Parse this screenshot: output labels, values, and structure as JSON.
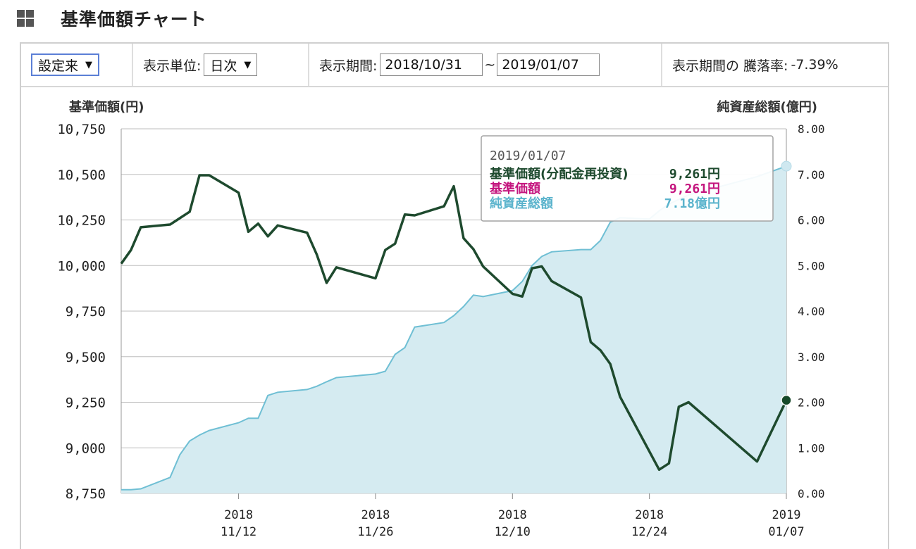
{
  "header": {
    "title": "基準価額チャート",
    "icon": "grid-icon"
  },
  "controls": {
    "period_select": "設定来",
    "unit_label": "表示単位:",
    "unit_select": "日次",
    "range_label": "表示期間:",
    "start_date": "2018/10/31",
    "range_sep": "~",
    "end_date": "2019/01/07",
    "change_label": "表示期間の 騰落率:",
    "change_value": "-7.39%"
  },
  "chart_data": {
    "type": "line",
    "left_axis_label": "基準価額(円)",
    "right_axis_label": "純資産総額(億円)",
    "y_left_ticks": [
      "10,750",
      "10,500",
      "10,250",
      "10,000",
      "9,750",
      "9,500",
      "9,250",
      "9,000",
      "8,750"
    ],
    "y_right_ticks": [
      "8.00",
      "7.00",
      "6.00",
      "5.00",
      "4.00",
      "3.00",
      "2.00",
      "1.00",
      "0.00"
    ],
    "ylim_left": [
      8750,
      10750
    ],
    "ylim_right": [
      0,
      8
    ],
    "x_ticks": [
      {
        "year": "2018",
        "md": "11/12",
        "date": "2018-11-12"
      },
      {
        "year": "2018",
        "md": "11/26",
        "date": "2018-11-26"
      },
      {
        "year": "2018",
        "md": "12/10",
        "date": "2018-12-10"
      },
      {
        "year": "2018",
        "md": "12/24",
        "date": "2018-12-24"
      },
      {
        "year": "2019",
        "md": "01/07",
        "date": "2019-01-07"
      }
    ],
    "xlim": [
      "2018-10-31",
      "2019-01-07"
    ],
    "grid": true,
    "nav_color": "#1e4a2e",
    "aum_line_color": "#6fbfd4",
    "aum_fill_color": "#d5ebf1",
    "series": [
      {
        "axis": "left",
        "points": [
          [
            "2018-10-31",
            10010
          ],
          [
            "2018-11-01",
            10085
          ],
          [
            "2018-11-02",
            10210
          ],
          [
            "2018-11-05",
            10225
          ],
          [
            "2018-11-07",
            10295
          ],
          [
            "2018-11-08",
            10495
          ],
          [
            "2018-11-09",
            10495
          ],
          [
            "2018-11-12",
            10400
          ],
          [
            "2018-11-13",
            10185
          ],
          [
            "2018-11-14",
            10230
          ],
          [
            "2018-11-15",
            10160
          ],
          [
            "2018-11-16",
            10220
          ],
          [
            "2018-11-19",
            10180
          ],
          [
            "2018-11-20",
            10060
          ],
          [
            "2018-11-21",
            9905
          ],
          [
            "2018-11-22",
            9990
          ],
          [
            "2018-11-26",
            9930
          ],
          [
            "2018-11-27",
            10085
          ],
          [
            "2018-11-28",
            10120
          ],
          [
            "2018-11-29",
            10280
          ],
          [
            "2018-11-30",
            10275
          ],
          [
            "2018-12-03",
            10325
          ],
          [
            "2018-12-04",
            10435
          ],
          [
            "2018-12-05",
            10150
          ],
          [
            "2018-12-06",
            10090
          ],
          [
            "2018-12-07",
            9995
          ],
          [
            "2018-12-10",
            9845
          ],
          [
            "2018-12-11",
            9830
          ],
          [
            "2018-12-12",
            9985
          ],
          [
            "2018-12-13",
            9995
          ],
          [
            "2018-12-14",
            9915
          ],
          [
            "2018-12-17",
            9825
          ],
          [
            "2018-12-18",
            9580
          ],
          [
            "2018-12-19",
            9535
          ],
          [
            "2018-12-20",
            9460
          ],
          [
            "2018-12-21",
            9280
          ],
          [
            "2018-12-25",
            8880
          ],
          [
            "2018-12-26",
            8915
          ],
          [
            "2018-12-27",
            9225
          ],
          [
            "2018-12-28",
            9250
          ],
          [
            "2019-01-04",
            8925
          ],
          [
            "2019-01-07",
            9261
          ]
        ]
      },
      {
        "axis": "right",
        "points": [
          [
            "2018-10-31",
            0.08
          ],
          [
            "2018-11-01",
            0.08
          ],
          [
            "2018-11-02",
            0.1
          ],
          [
            "2018-11-05",
            0.35
          ],
          [
            "2018-11-06",
            0.85
          ],
          [
            "2018-11-07",
            1.15
          ],
          [
            "2018-11-08",
            1.28
          ],
          [
            "2018-11-09",
            1.38
          ],
          [
            "2018-11-12",
            1.55
          ],
          [
            "2018-11-13",
            1.65
          ],
          [
            "2018-11-14",
            1.65
          ],
          [
            "2018-11-15",
            2.15
          ],
          [
            "2018-11-16",
            2.22
          ],
          [
            "2018-11-19",
            2.28
          ],
          [
            "2018-11-20",
            2.35
          ],
          [
            "2018-11-21",
            2.45
          ],
          [
            "2018-11-22",
            2.54
          ],
          [
            "2018-11-26",
            2.62
          ],
          [
            "2018-11-27",
            2.68
          ],
          [
            "2018-11-28",
            3.05
          ],
          [
            "2018-11-29",
            3.2
          ],
          [
            "2018-11-30",
            3.65
          ],
          [
            "2018-12-03",
            3.75
          ],
          [
            "2018-12-04",
            3.9
          ],
          [
            "2018-12-05",
            4.1
          ],
          [
            "2018-12-06",
            4.35
          ],
          [
            "2018-12-07",
            4.32
          ],
          [
            "2018-12-10",
            4.45
          ],
          [
            "2018-12-11",
            4.65
          ],
          [
            "2018-12-12",
            5.0
          ],
          [
            "2018-12-13",
            5.2
          ],
          [
            "2018-12-14",
            5.3
          ],
          [
            "2018-12-17",
            5.35
          ],
          [
            "2018-12-18",
            5.35
          ],
          [
            "2018-12-19",
            5.55
          ],
          [
            "2018-12-20",
            5.95
          ],
          [
            "2018-12-21",
            6.05
          ],
          [
            "2018-12-24",
            6.02
          ],
          [
            "2018-12-25",
            6.2
          ],
          [
            "2018-12-26",
            6.35
          ],
          [
            "2018-12-27",
            6.45
          ],
          [
            "2018-12-28",
            6.55
          ],
          [
            "2019-01-04",
            6.95
          ],
          [
            "2019-01-07",
            7.18
          ]
        ]
      }
    ],
    "tooltip": {
      "date": "2019/01/07",
      "rows": [
        {
          "label": "基準価額(分配金再投資)",
          "value": "9,261円",
          "color": "#1e4a2e"
        },
        {
          "label": "基準価額",
          "value": "9,261円",
          "color": "#c4157e"
        },
        {
          "label": "純資産総額",
          "value": "7.18億円",
          "color": "#5ab3cc"
        }
      ]
    }
  }
}
